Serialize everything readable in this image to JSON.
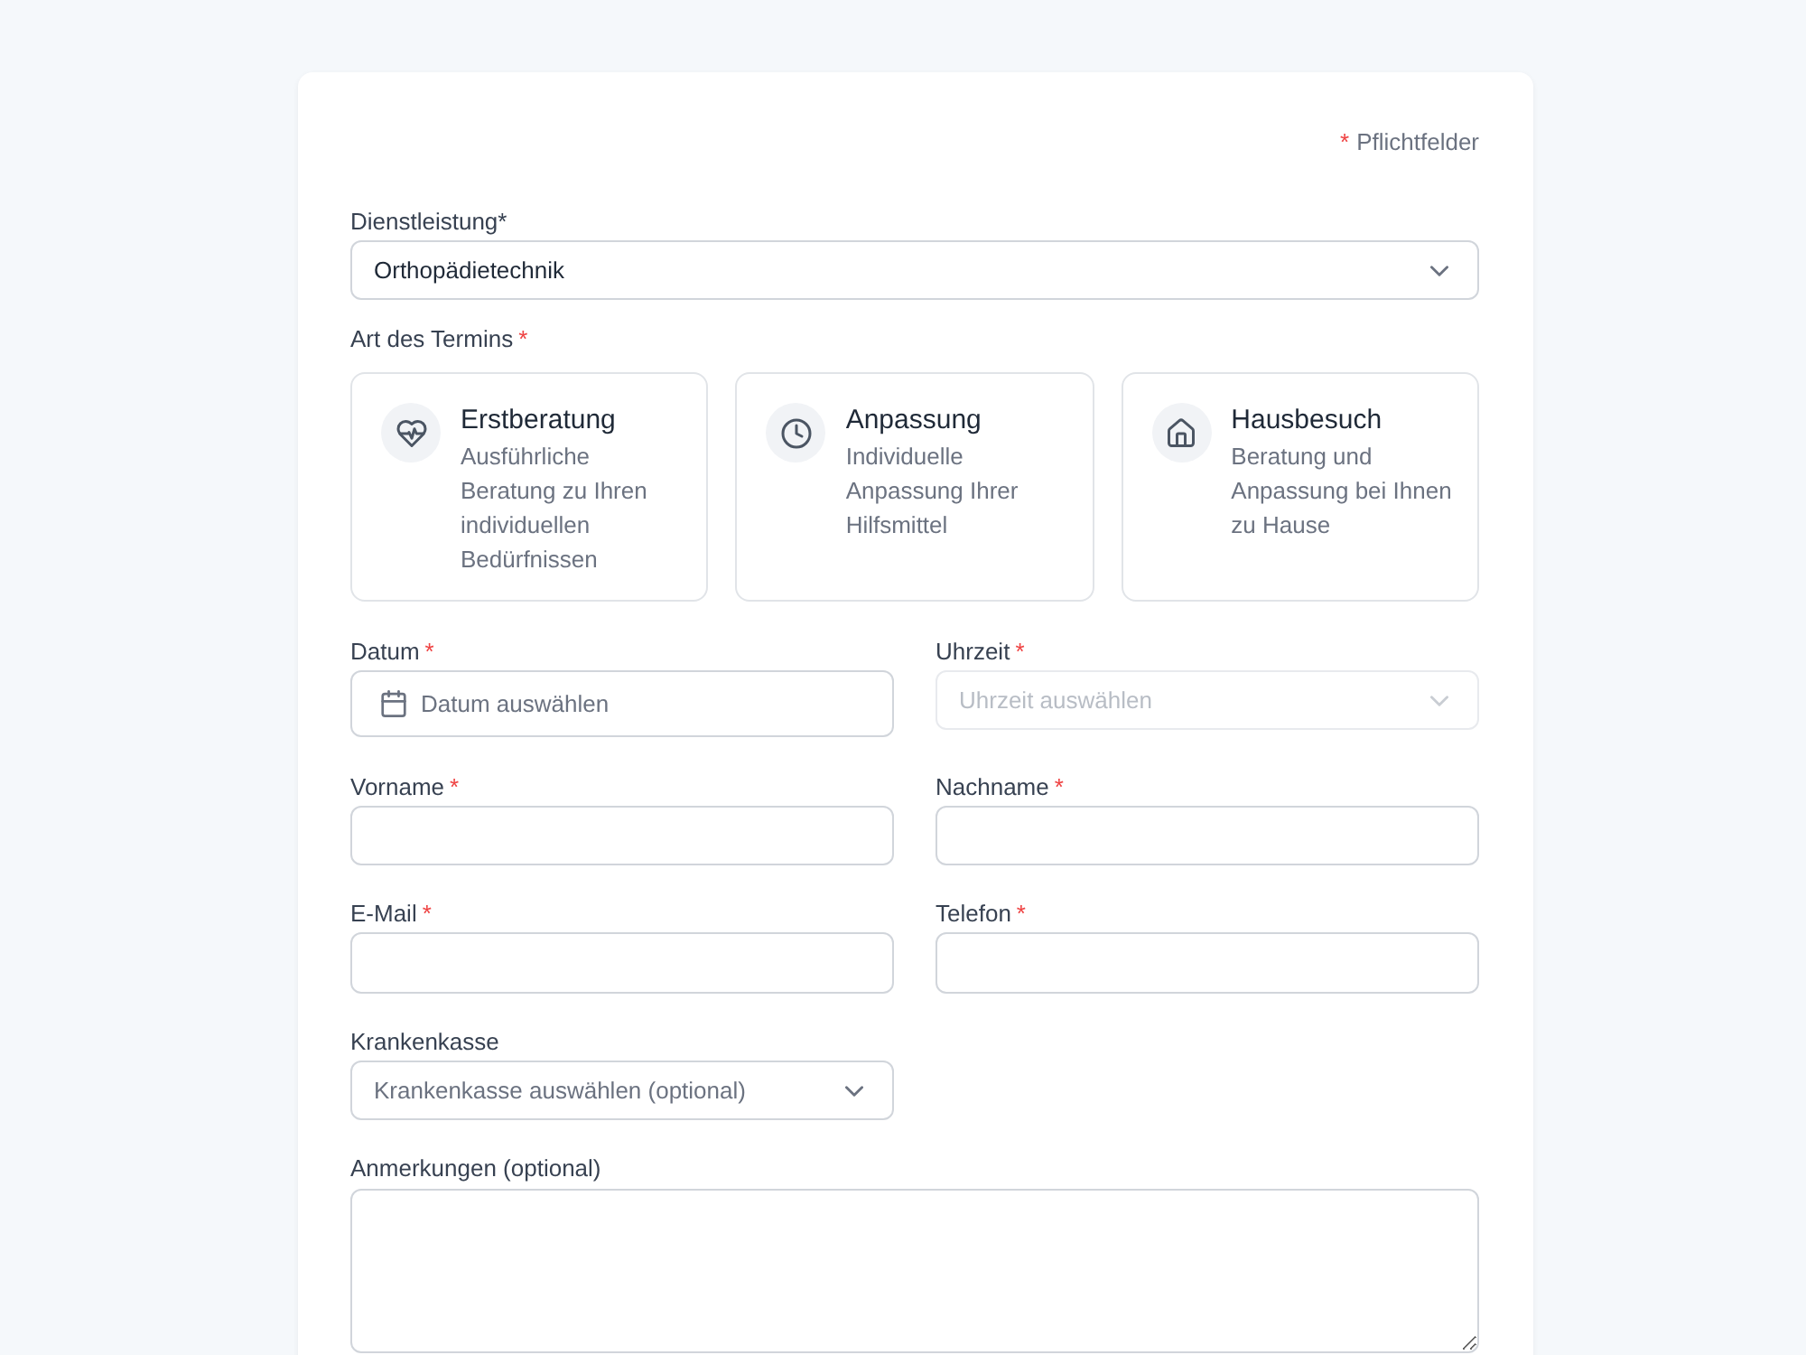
{
  "required_note": {
    "mark": "*",
    "text": "Pflichtfelder"
  },
  "service": {
    "label": "Dienstleistung*",
    "value": "Orthopädietechnik"
  },
  "appointment_type": {
    "label": "Art des Termins",
    "required_mark": "*",
    "options": [
      {
        "kind": "consultation",
        "title": "Erstberatung",
        "description": "Ausführliche Beratung zu Ihren individuellen Bedürfnissen",
        "selected": false
      },
      {
        "kind": "fitting",
        "title": "Anpassung",
        "description": "Individuelle Anpassung Ihrer Hilfsmittel",
        "selected": false
      },
      {
        "kind": "visit",
        "title": "Hausbesuch",
        "description": "Beratung und Anpassung bei Ihnen zu Hause",
        "selected": false
      }
    ]
  },
  "date": {
    "label": "Datum",
    "required_mark": "*",
    "placeholder": "Datum auswählen"
  },
  "time": {
    "label": "Uhrzeit",
    "required_mark": "*",
    "placeholder": "Uhrzeit auswählen",
    "disabled": true
  },
  "first_name": {
    "label": "Vorname",
    "required_mark": "*"
  },
  "last_name": {
    "label": "Nachname",
    "required_mark": "*"
  },
  "email": {
    "label": "E-Mail",
    "required_mark": "*"
  },
  "phone": {
    "label": "Telefon",
    "required_mark": "*"
  },
  "insurance": {
    "label": "Krankenkasse",
    "placeholder": "Krankenkasse auswählen (optional)"
  },
  "notes": {
    "label": "Anmerkungen (optional)"
  }
}
